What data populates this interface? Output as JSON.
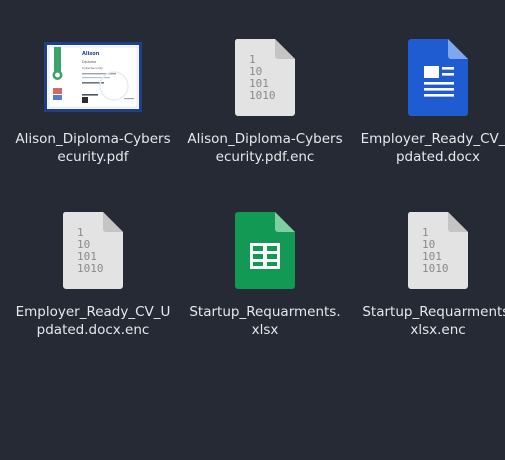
{
  "files": [
    {
      "name": "Alison_Diploma-Cybersecurity.pdf",
      "type": "pdf-thumbnail",
      "icon": "certificate-thumbnail-icon"
    },
    {
      "name": "Alison_Diploma-Cybersecurity.pdf.enc",
      "type": "binary",
      "icon": "binary-file-icon"
    },
    {
      "name": "Employer_Ready_CV_Updated.docx",
      "type": "document",
      "icon": "document-file-icon"
    },
    {
      "name": "Employer_Ready_CV_Updated.docx.enc",
      "type": "binary",
      "icon": "binary-file-icon"
    },
    {
      "name": "Startup_Requarments.xlsx",
      "type": "spreadsheet",
      "icon": "spreadsheet-file-icon"
    },
    {
      "name": "Startup_Requarments.xlsx.enc",
      "type": "binary",
      "icon": "binary-file-icon"
    }
  ],
  "certificate": {
    "brand": "Alison",
    "heading": "Diploma",
    "subheading": "Cybersecurity"
  },
  "binary_glyph": [
    "1",
    "10",
    "101",
    "1010"
  ],
  "colors": {
    "background": "#262a35",
    "binary_page": "#e3e3e3",
    "binary_fold": "#c4c4c4",
    "binary_text": "#8a8a8a",
    "doc_blue": "#1f5bd1",
    "doc_fold": "#7ea7ee",
    "sheet_green": "#129a55",
    "sheet_fold": "#7dcfa4",
    "cert_frame": "#1f3f8a",
    "cert_accent": "#3aa46b"
  }
}
